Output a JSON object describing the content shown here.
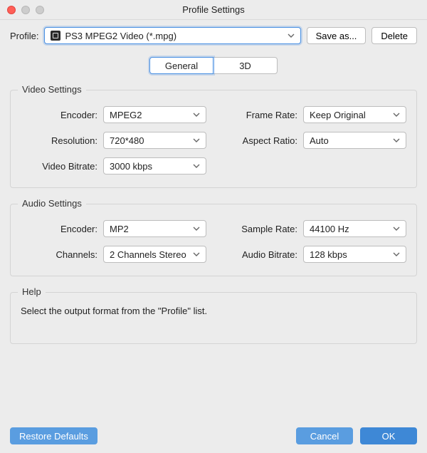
{
  "window": {
    "title": "Profile Settings"
  },
  "profile": {
    "label": "Profile:",
    "value": "PS3 MPEG2 Video (*.mpg)",
    "save_as_label": "Save as...",
    "delete_label": "Delete"
  },
  "tabs": {
    "general": "General",
    "three_d": "3D",
    "active": "general"
  },
  "video": {
    "title": "Video Settings",
    "encoder_label": "Encoder:",
    "encoder_value": "MPEG2",
    "resolution_label": "Resolution:",
    "resolution_value": "720*480",
    "video_bitrate_label": "Video Bitrate:",
    "video_bitrate_value": "3000 kbps",
    "frame_rate_label": "Frame Rate:",
    "frame_rate_value": "Keep Original",
    "aspect_ratio_label": "Aspect Ratio:",
    "aspect_ratio_value": "Auto"
  },
  "audio": {
    "title": "Audio Settings",
    "encoder_label": "Encoder:",
    "encoder_value": "MP2",
    "channels_label": "Channels:",
    "channels_value": "2 Channels Stereo",
    "sample_rate_label": "Sample Rate:",
    "sample_rate_value": "44100 Hz",
    "audio_bitrate_label": "Audio Bitrate:",
    "audio_bitrate_value": "128 kbps"
  },
  "help": {
    "title": "Help",
    "text": "Select the output format from the \"Profile\" list."
  },
  "footer": {
    "restore_label": "Restore Defaults",
    "cancel_label": "Cancel",
    "ok_label": "OK"
  }
}
